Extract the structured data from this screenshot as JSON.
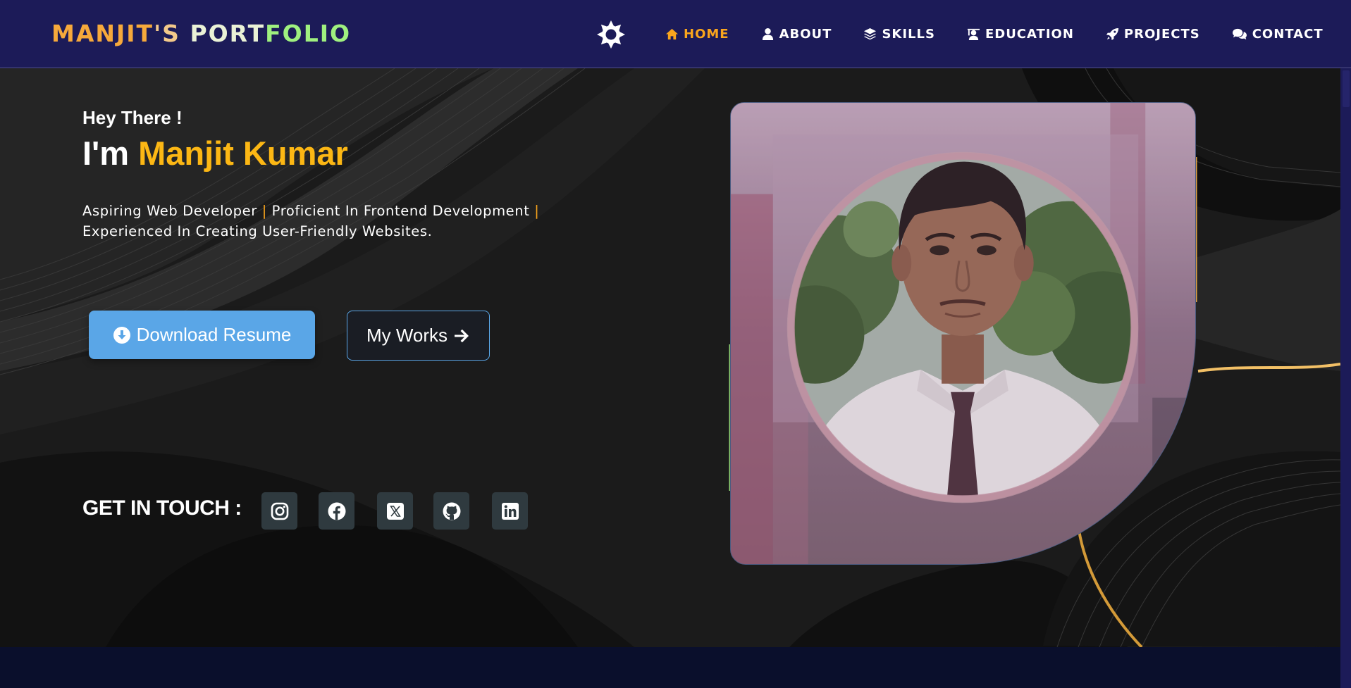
{
  "brand": {
    "parts": [
      "MANJIT",
      "'S ",
      "PORT",
      "FOLIO"
    ]
  },
  "theme_toggle": {
    "icon": "sun-gear-icon"
  },
  "nav": {
    "items": [
      {
        "label": "HOME",
        "icon": "home-icon",
        "active": true
      },
      {
        "label": "ABOUT",
        "icon": "user-icon",
        "active": false
      },
      {
        "label": "SKILLS",
        "icon": "layers-icon",
        "active": false
      },
      {
        "label": "EDUCATION",
        "icon": "graduation-icon",
        "active": false
      },
      {
        "label": "PROJECTS",
        "icon": "rocket-icon",
        "active": false
      },
      {
        "label": "CONTACT",
        "icon": "comments-icon",
        "active": false
      }
    ]
  },
  "hero": {
    "greeting": "Hey There !",
    "name_prefix": "I'm ",
    "name": "Manjit Kumar",
    "tagline_1": "Aspiring Web Developer",
    "tagline_sep": "|",
    "tagline_2": "Proficient In Frontend Development",
    "tagline_3": "Experienced In Creating User-Friendly Websites.",
    "resume_button": "Download Resume",
    "works_button": "My Works"
  },
  "contact": {
    "label": "GET IN TOUCH :",
    "socials": [
      "instagram-icon",
      "facebook-icon",
      "x-twitter-icon",
      "github-icon",
      "linkedin-icon"
    ]
  },
  "colors": {
    "navbar_bg": "#1c1b58",
    "accent_orange": "#f9a51d",
    "name_gold": "#fcb714",
    "resume_blue": "#5aa6e7",
    "hero_bg": "#1b1b1b",
    "social_bg": "#2f3a3f"
  }
}
